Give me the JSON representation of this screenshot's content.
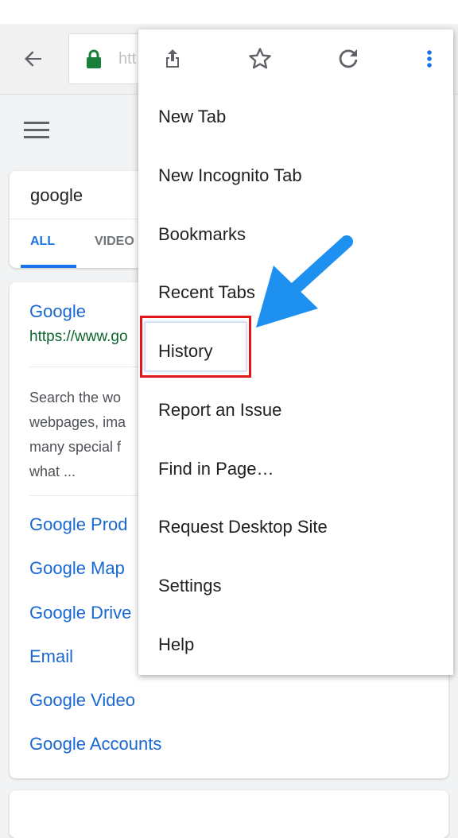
{
  "toolbar": {
    "url_partial": "htt"
  },
  "search": {
    "query": "google",
    "tabs": [
      "ALL",
      "VIDEO"
    ]
  },
  "result": {
    "title": "Google",
    "url": "https://www.go",
    "snippet_lines": [
      "Search the wo",
      "webpages, ima",
      "many special f",
      "what ..."
    ],
    "sitelinks": [
      "Google Prod",
      "Google Map",
      "Google Drive",
      "Email",
      "Google Video",
      "Google Accounts"
    ]
  },
  "menu": {
    "items": [
      "New Tab",
      "New Incognito Tab",
      "Bookmarks",
      "Recent Tabs",
      "History",
      "Report an Issue",
      "Find in Page…",
      "Request Desktop Site",
      "Settings",
      "Help"
    ]
  },
  "colors": {
    "accent": "#1a73e8",
    "link": "#1967d2",
    "url_green": "#0d652d",
    "highlight_red": "#e0161b",
    "arrow_blue": "#1e90f0"
  }
}
